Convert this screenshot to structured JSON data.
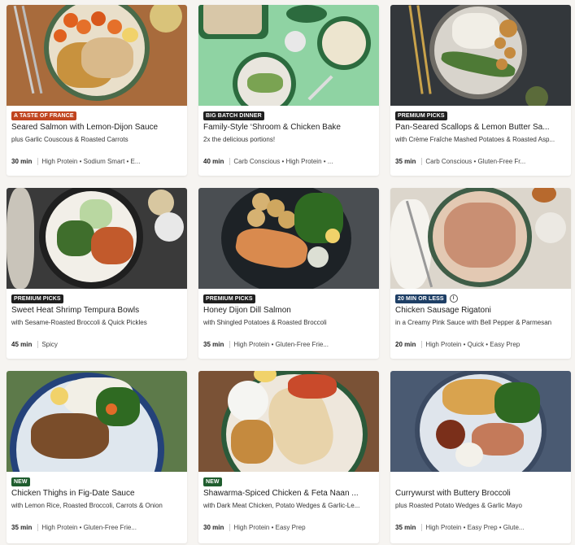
{
  "cards": [
    {
      "tag": "A TASTE OF FRANCE",
      "tag_color": "#c0441f",
      "title": "Seared Salmon with Lemon-Dijon Sauce",
      "subtitle": "plus Garlic Couscous & Roasted Carrots",
      "time": "30 min",
      "tags": "High Protein • Sodium Smart • E...",
      "info": false
    },
    {
      "tag": "BIG BATCH DINNER",
      "tag_color": "#1f1f1f",
      "title": "Family-Style ‘Shroom & Chicken Bake",
      "subtitle": "2x the delicious portions!",
      "time": "40 min",
      "tags": "Carb Conscious • High Protein • ...",
      "info": false
    },
    {
      "tag": "PREMIUM PICKS",
      "tag_color": "#1f1f1f",
      "title": "Pan-Seared Scallops & Lemon Butter Sa...",
      "subtitle": "with Crème Fraîche Mashed Potatoes & Roasted Asp...",
      "time": "35 min",
      "tags": "Carb Conscious • Gluten-Free Fr...",
      "info": false
    },
    {
      "tag": "PREMIUM PICKS",
      "tag_color": "#1f1f1f",
      "title": "Sweet Heat Shrimp Tempura Bowls",
      "subtitle": "with Sesame-Roasted Broccoli & Quick Pickles",
      "time": "45 min",
      "tags": "Spicy",
      "info": false
    },
    {
      "tag": "PREMIUM PICKS",
      "tag_color": "#1f1f1f",
      "title": "Honey Dijon Dill Salmon",
      "subtitle": "with Shingled Potatoes & Roasted Broccoli",
      "time": "35 min",
      "tags": "High Protein • Gluten-Free Frie...",
      "info": false
    },
    {
      "tag": "20 MIN OR LESS",
      "tag_color": "#1e3f66",
      "title": "Chicken Sausage Rigatoni",
      "subtitle": "in a Creamy Pink Sauce with Bell Pepper & Parmesan",
      "time": "20 min",
      "tags": "High Protein • Quick • Easy Prep",
      "info": true
    },
    {
      "tag": "NEW",
      "tag_color": "#1f5d2e",
      "title": "Chicken Thighs in Fig-Date Sauce",
      "subtitle": "with Lemon Rice, Roasted Broccoli, Carrots & Onion",
      "time": "35 min",
      "tags": "High Protein • Gluten-Free Frie...",
      "info": false
    },
    {
      "tag": "NEW",
      "tag_color": "#1f5d2e",
      "title": "Shawarma-Spiced Chicken & Feta Naan ...",
      "subtitle": "with Dark Meat Chicken, Potato Wedges & Garlic-Le...",
      "time": "30 min",
      "tags": "High Protein • Easy Prep",
      "info": false
    },
    {
      "tag": "",
      "tag_color": "",
      "title": "Currywurst with Buttery Broccoli",
      "subtitle": "plus Roasted Potato Wedges & Garlic Mayo",
      "time": "35 min",
      "tags": "High Protein • Easy Prep • Glute...",
      "info": false
    }
  ]
}
